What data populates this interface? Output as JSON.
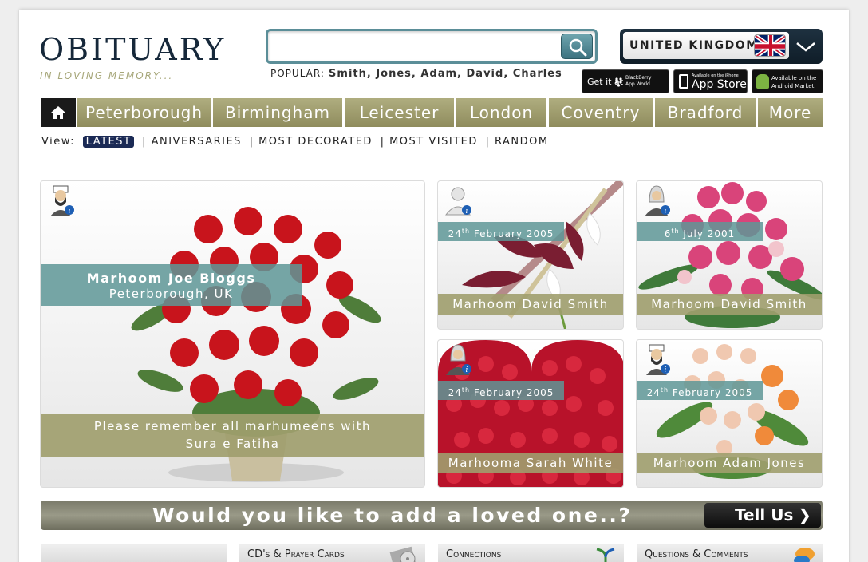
{
  "brand": {
    "title": "OBITUARY",
    "tagline": "IN LOVING MEMORY..."
  },
  "search": {
    "value": "",
    "placeholder": ""
  },
  "popular": {
    "label": "POPULAR:",
    "names": "Smith, Jones, Adam, David, Charles"
  },
  "country": {
    "label": "UNITED KINGDOM"
  },
  "stores": {
    "blackberry": {
      "line1": "Get it at",
      "line2a": "BlackBerry",
      "line2b": "App World."
    },
    "apple": {
      "small": "Available on the iPhone",
      "big": "App Store"
    },
    "android": {
      "line1": "Available on the",
      "line2": "Android Market"
    }
  },
  "nav": {
    "items": [
      {
        "label": "Peterborough"
      },
      {
        "label": "Birmingham"
      },
      {
        "label": "Leicester"
      },
      {
        "label": "London"
      },
      {
        "label": "Coventry"
      },
      {
        "label": "Bradford"
      },
      {
        "label": "More"
      }
    ]
  },
  "view": {
    "label": "View:",
    "tabs": [
      {
        "label": "LATEST"
      },
      {
        "label": "| ANIVERSARIES"
      },
      {
        "label": "| MOST DECORATED"
      },
      {
        "label": "| MOST VISITED"
      },
      {
        "label": "| RANDOM"
      }
    ]
  },
  "featured": {
    "name": "Marhoom Joe Bloggs",
    "location": "Peterborough, UK",
    "message_line1": "Please remember all marhumeens with",
    "message_line2": "Sura e Fatiha"
  },
  "cards": [
    {
      "date_day": "24",
      "date_sup": "th",
      "date_rest": "February 2005",
      "name": "Marhoom David Smith"
    },
    {
      "date_day": "6",
      "date_sup": "th",
      "date_rest": "July 2001",
      "name": "Marhoom David Smith"
    },
    {
      "date_day": "24",
      "date_sup": "th",
      "date_rest": "February 2005",
      "name": "Marhooma Sarah White"
    },
    {
      "date_day": "24",
      "date_sup": "th",
      "date_rest": "February 2005",
      "name": "Marhoom Adam Jones"
    }
  ],
  "banner": {
    "text": "Would you like to add a loved one..?",
    "button": "Tell Us",
    "chevron": "❯"
  },
  "bottom": [
    {
      "label": ""
    },
    {
      "label": "CD's & Prayer Cards"
    },
    {
      "label": "Connections"
    },
    {
      "label": "Questions & Comments"
    }
  ],
  "colors": {
    "accent_olive": "#a09e6e",
    "accent_teal": "#5e9696",
    "dark_navy": "#16283a"
  }
}
